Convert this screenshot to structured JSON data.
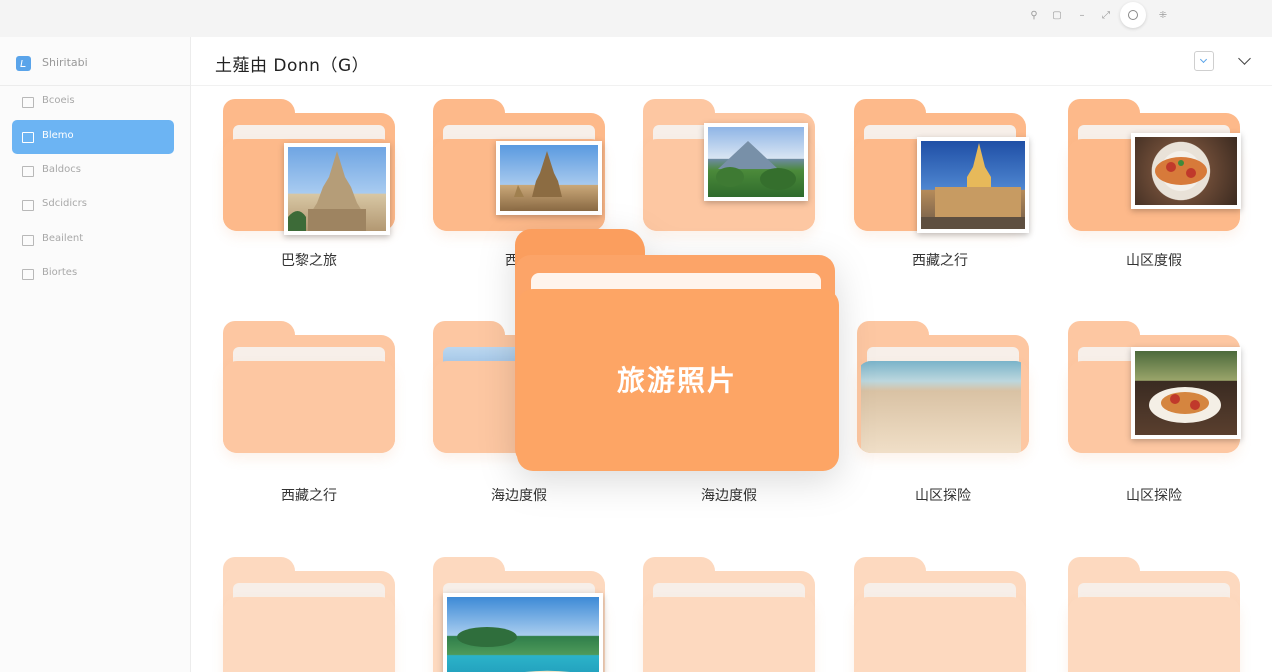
{
  "topbar": {
    "icons": [
      "person-icon",
      "window-icon",
      "minus-icon",
      "expand-icon",
      "circle-button-icon",
      "grid-icon"
    ]
  },
  "sidebar": {
    "title": "Shiritabi",
    "items": [
      {
        "label": "Bcoeis",
        "active": false
      },
      {
        "label": "Blemo",
        "active": true
      },
      {
        "label": "Baldocs",
        "active": false
      },
      {
        "label": "Sdcidicrs",
        "active": false
      },
      {
        "label": "Beailent",
        "active": false
      },
      {
        "label": "Biortes",
        "active": false
      }
    ]
  },
  "header": {
    "path": "土薤由 Donn（G）"
  },
  "folders": [
    {
      "label": "巴黎之旅",
      "tone": "c1",
      "image": "stupa"
    },
    {
      "label": "西藏",
      "tone": "c1",
      "image": "stupa2"
    },
    {
      "label": "",
      "tone": "c2",
      "image": "mountain"
    },
    {
      "label": "西藏之行",
      "tone": "c1",
      "image": "cathedral"
    },
    {
      "label": "山区度假",
      "tone": "c1",
      "image": "food"
    },
    {
      "label": "西藏之行",
      "tone": "c2",
      "image": ""
    },
    {
      "label": "海边度假",
      "tone": "c2",
      "image": "blue"
    },
    {
      "label": "海边度假",
      "tone": "c2",
      "image": ""
    },
    {
      "label": "山区探险",
      "tone": "c2",
      "image": "sand"
    },
    {
      "label": "山区探险",
      "tone": "c2",
      "image": "food2"
    },
    {
      "label": "",
      "tone": "c3",
      "image": ""
    },
    {
      "label": "",
      "tone": "c3",
      "image": "beach"
    },
    {
      "label": "",
      "tone": "c3",
      "image": ""
    },
    {
      "label": "",
      "tone": "c3",
      "image": ""
    },
    {
      "label": "",
      "tone": "c3",
      "image": ""
    }
  ],
  "dragged_folder": {
    "label": "旅游照片"
  },
  "colors": {
    "accent": "#6cb4f3",
    "folder": "#fdb98a",
    "folder_active": "#fca468"
  }
}
